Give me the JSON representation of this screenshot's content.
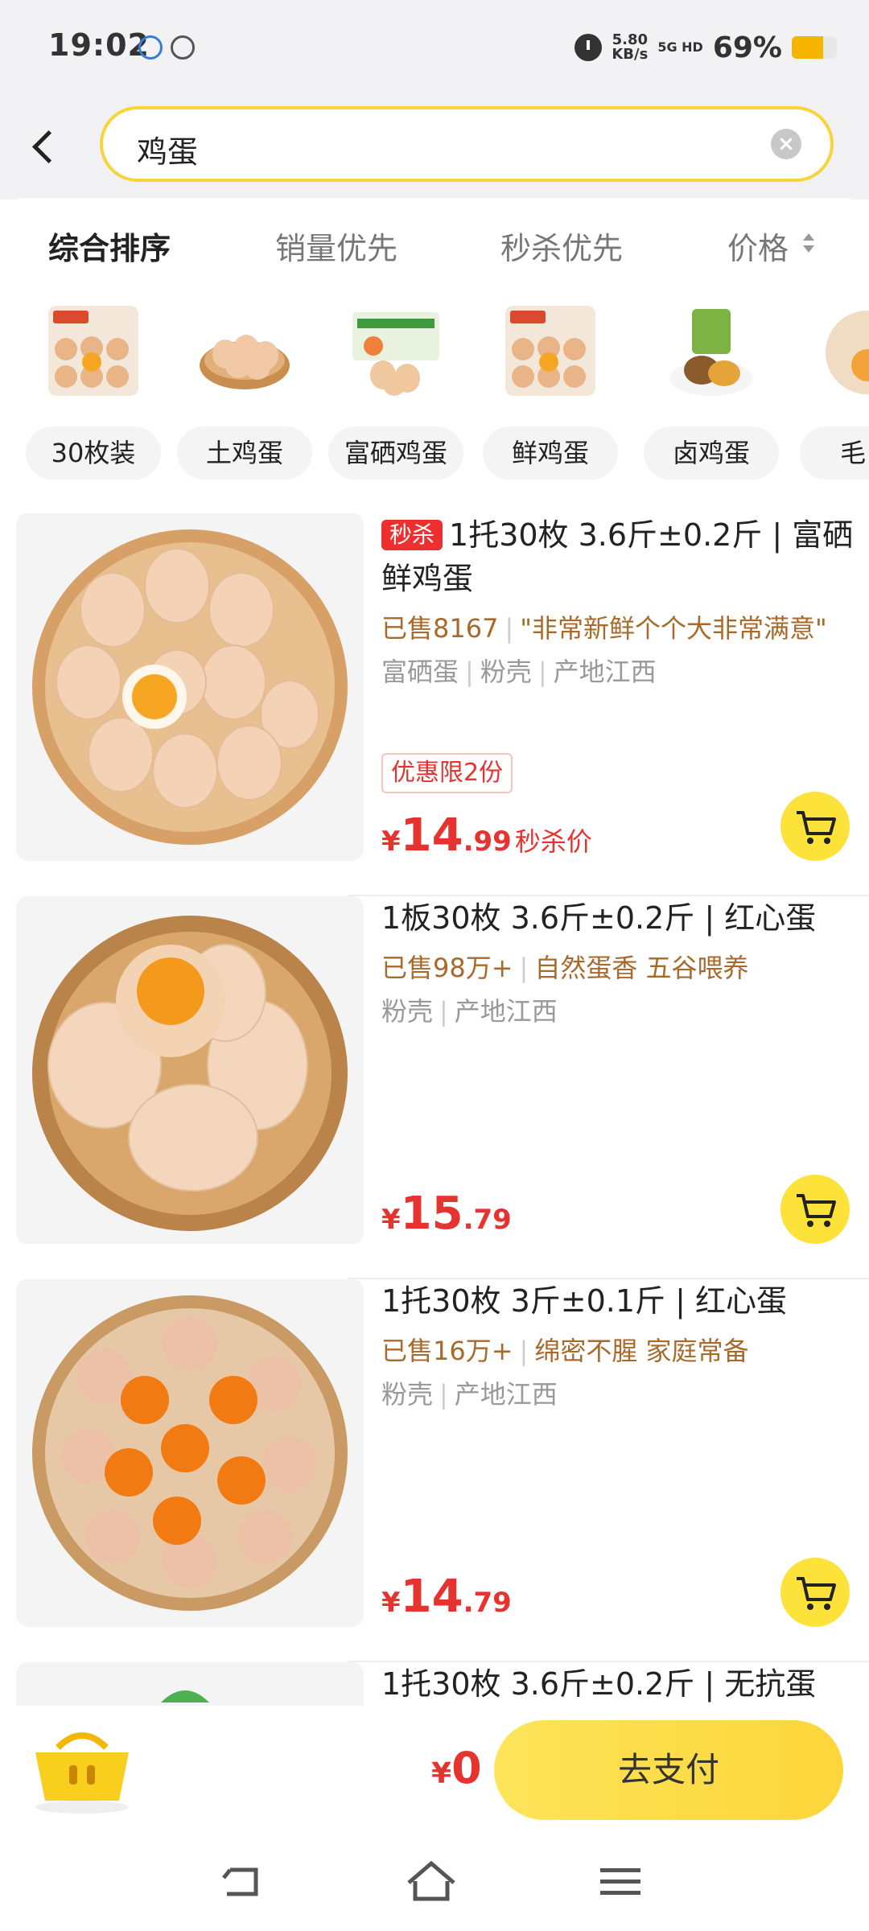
{
  "status_bar": {
    "time": "19:02",
    "net_speed_value": "5.80",
    "net_speed_unit": "KB/s",
    "signal": "5G HD",
    "battery_percent": "69%",
    "battery_level": 0.69
  },
  "search": {
    "query": "鸡蛋"
  },
  "sort_tabs": [
    {
      "label": "综合排序",
      "active": true
    },
    {
      "label": "销量优先",
      "active": false
    },
    {
      "label": "秒杀优先",
      "active": false
    },
    {
      "label": "价格",
      "active": false
    }
  ],
  "categories": [
    {
      "label": "30枚装",
      "icon": "egg-tray-image"
    },
    {
      "label": "土鸡蛋",
      "icon": "egg-basket-image"
    },
    {
      "label": "富硒鸡蛋",
      "icon": "egg-box-image"
    },
    {
      "label": "鲜鸡蛋",
      "icon": "egg-tray-image"
    },
    {
      "label": "卤鸡蛋",
      "icon": "braised-egg-image"
    },
    {
      "label": "毛",
      "icon": "egg-image"
    }
  ],
  "products": [
    {
      "badge": "秒杀",
      "title": "1托30枚 3.6斤±0.2斤 | 富硒鲜鸡蛋",
      "sold": "已售8167",
      "highlight": "\"非常新鲜个个大非常满意\"",
      "tags": [
        "富硒蛋",
        "粉壳",
        "产地江西"
      ],
      "promo": "优惠限2份",
      "currency": "¥",
      "price_int": "14",
      "price_dec": ".99",
      "price_label": "秒杀价"
    },
    {
      "badge": "",
      "title": "1板30枚 3.6斤±0.2斤 | 红心蛋",
      "sold": "已售98万+",
      "highlight": "自然蛋香 五谷喂养",
      "tags": [
        "粉壳",
        "产地江西"
      ],
      "promo": "",
      "currency": "¥",
      "price_int": "15",
      "price_dec": ".79",
      "price_label": ""
    },
    {
      "badge": "",
      "title": "1托30枚 3斤±0.1斤 | 红心蛋",
      "sold": "已售16万+",
      "highlight": "绵密不腥 家庭常备",
      "tags": [
        "粉壳",
        "产地江西"
      ],
      "promo": "",
      "currency": "¥",
      "price_int": "14",
      "price_dec": ".79",
      "price_label": ""
    },
    {
      "badge": "",
      "title": "1托30枚 3.6斤±0.2斤 | 无抗蛋"
    }
  ],
  "checkout": {
    "currency": "¥",
    "total": "0",
    "pay_label": "去支付"
  },
  "colors": {
    "accent_yellow": "#fde23a",
    "price_red": "#e7332f",
    "sales_brown": "#a86a2b"
  }
}
